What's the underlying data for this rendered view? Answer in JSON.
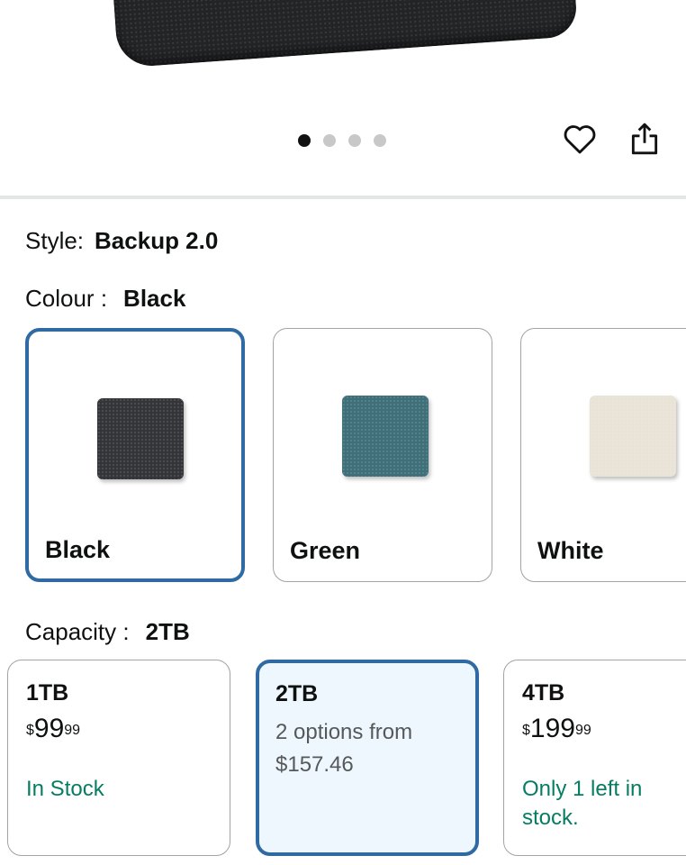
{
  "gallery": {
    "dot_count": 4,
    "active_dot_index": 0,
    "wishlist_icon": "heart-outline-icon",
    "share_icon": "share-icon"
  },
  "style": {
    "key": "Style:",
    "value": "Backup 2.0"
  },
  "colour": {
    "key": "Colour :",
    "value": "Black",
    "options": [
      {
        "name": "Black",
        "swatch_color": "#343538",
        "selected": true
      },
      {
        "name": "Green",
        "swatch_color": "#3f6f78",
        "selected": false
      },
      {
        "name": "White",
        "swatch_color": "#e8e3d6",
        "selected": false
      }
    ]
  },
  "capacity": {
    "key": "Capacity :",
    "value": "2TB",
    "options": [
      {
        "label": "1TB",
        "currency": "$",
        "whole": "99",
        "cents": "99",
        "stock": "In Stock",
        "selected": false
      },
      {
        "label": "2TB",
        "options_line1": "2 options from",
        "options_line2": "$157.46",
        "selected": true
      },
      {
        "label": "4TB",
        "currency": "$",
        "whole": "199",
        "cents": "99",
        "stock": "Only 1 left in stock.",
        "selected": false
      }
    ]
  },
  "colors": {
    "accent_border": "#2f6aa3",
    "selected_bg": "#edf7fd",
    "stock_green": "#067d62"
  }
}
